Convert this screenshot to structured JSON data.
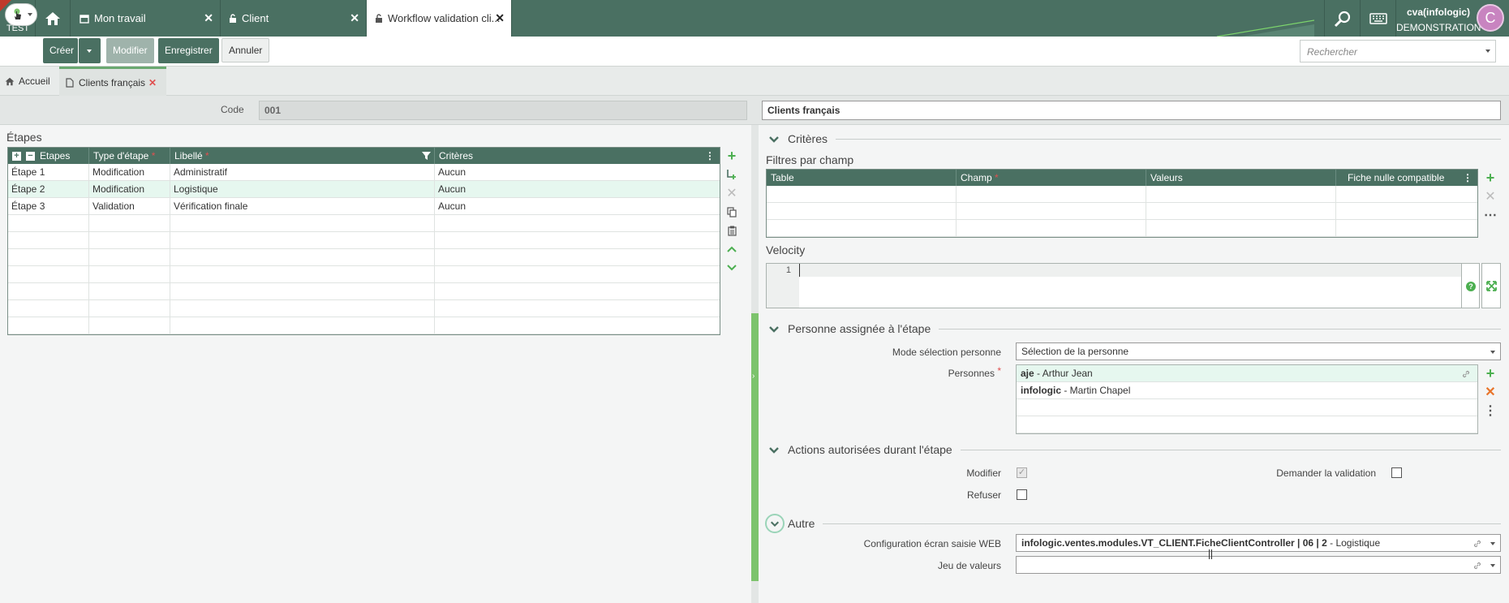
{
  "app": {
    "env_label": "TEST"
  },
  "tabs": [
    {
      "label": "Mon travail",
      "icon": "calendar-icon"
    },
    {
      "label": "Client",
      "icon": "lock-icon"
    },
    {
      "label": "Workflow validation cli...",
      "icon": "lock-icon"
    }
  ],
  "user": {
    "name": "cva(infologic)",
    "company": "DEMONSTRATION",
    "initial": "C"
  },
  "toolbar": {
    "create": "Créer",
    "modify": "Modifier",
    "save": "Enregistrer",
    "cancel": "Annuler",
    "search_placeholder": "Rechercher"
  },
  "breadcrumbs": [
    {
      "label": "Accueil"
    },
    {
      "label": "Clients français"
    }
  ],
  "header": {
    "code_label": "Code",
    "code_value": "001",
    "title_value": "Clients français"
  },
  "etapes": {
    "section_title": "Étapes",
    "columns": [
      {
        "label": "Etapes",
        "required": false
      },
      {
        "label": "Type d'étape",
        "required": true
      },
      {
        "label": "Libellé",
        "required": true
      },
      {
        "label": "Critères",
        "required": false
      }
    ],
    "rows": [
      [
        "Étape 1",
        "Modification",
        "Administratif",
        "Aucun"
      ],
      [
        "Étape 2",
        "Modification",
        "Logistique",
        "Aucun"
      ],
      [
        "Étape 3",
        "Validation",
        "Vérification finale",
        "Aucun"
      ]
    ],
    "selected_row": 1
  },
  "criteres": {
    "title": "Critères",
    "filters_label": "Filtres par champ",
    "columns": [
      {
        "label": "Table",
        "required": false
      },
      {
        "label": "Champ",
        "required": true
      },
      {
        "label": "Valeurs",
        "required": false
      },
      {
        "label": "Fiche nulle compatible",
        "required": false
      }
    ],
    "velocity_label": "Velocity",
    "velocity_line": "1"
  },
  "personne": {
    "title": "Personne assignée à l'étape",
    "mode_label": "Mode sélection personne",
    "mode_value": "Sélection de la personne",
    "persons_label": "Personnes",
    "persons": [
      {
        "code": "aje",
        "name": " - Arthur Jean"
      },
      {
        "code": "infologic",
        "name": " - Martin Chapel"
      }
    ]
  },
  "actions": {
    "title": "Actions autorisées durant l'étape",
    "modify_label": "Modifier",
    "modify_checked": true,
    "refuse_label": "Refuser",
    "refuse_checked": false,
    "request_label": "Demander la validation",
    "request_checked": false
  },
  "autre": {
    "title": "Autre",
    "config_label": "Configuration écran saisie WEB",
    "config_bold": "infologic.ventes.modules.VT_CLIENT.FicheClientController | 06 | 2",
    "config_rest": " - Logistique",
    "jeu_label": "Jeu de valeurs",
    "jeu_value": ""
  },
  "colors": {
    "primary": "#4a7062",
    "accent_green": "#6aa870",
    "highlight_row": "#e6f7ef",
    "danger": "#e05050"
  }
}
